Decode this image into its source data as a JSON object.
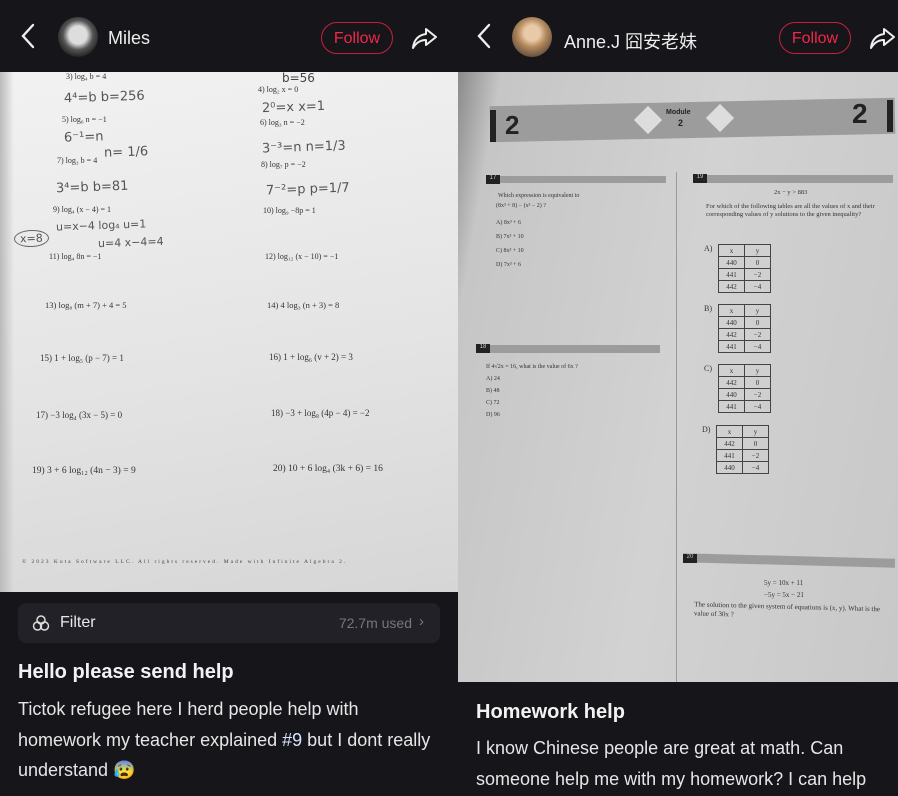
{
  "left_post": {
    "header": {
      "username": "Miles",
      "follow_label": "Follow"
    },
    "worksheet": {
      "problems": [
        "3) log₄ b = 4",
        "4) log₂ x = 0",
        "5) log₆ n = −1",
        "6) log₃ n = −2",
        "7) log₃ b = 4",
        "8) log₇ p = −2",
        "9) log₄ (x − 4) = 1",
        "10) log₉ −8p = 1",
        "11) log₄ 8n = −1",
        "12) log₁₂ (x − 10) = −1",
        "13) log₈ (m + 7) + 4 = 5",
        "14) 4 log₃ (n + 3) = 8",
        "15) 1 + log₅ (p − 7) = 1",
        "16) 1 + log₆ (v + 2) = 3",
        "17) −3 log₄ (3x − 5) = 0",
        "18) −3 + log₈ (4p − 4) = −2",
        "19) 3 + 6 log₁₂ (4n − 3) = 9",
        "20) 10 + 6 log₄ (3k + 6) = 16"
      ],
      "handwriting": [
        "4⁴=b  b=256",
        "2⁰=x   x=1",
        "6⁻¹=n",
        "n= 1/6",
        "3⁻³=n  n=1/3",
        "3⁴=b    b=81",
        "7⁻²=p   p=1/7",
        "u=x−4    log₄ u=1",
        "u=4  x−4=4",
        "x=8",
        "b=56"
      ],
      "footer": "© 2023 Kuta Software LLC.  All rights reserved.   Made with Infinite Algebra 2."
    },
    "filter": {
      "label": "Filter",
      "usage": "72.7m used",
      "icon": "filter-icon"
    },
    "title": "Hello please send help",
    "body": {
      "text_before": "Tictok refugee here I herd people help with homework my teacher explained ",
      "hashtag": "#9",
      "text_after": " but I dont really understand",
      "emoji": "😰"
    }
  },
  "right_post": {
    "header": {
      "username": "Anne.J 囧安老妹",
      "follow_label": "Follow"
    },
    "worksheet": {
      "module_left": "2",
      "module_label": "Module",
      "module_number": "2",
      "module_right": "2",
      "q17": {
        "num": "17",
        "prompt": "Which expression is equivalent to",
        "expr": "(8x³ + 8) − (x³ − 2) ?",
        "choices": [
          "A) 8x³ + 6",
          "B) 7x³ + 10",
          "C) 8x³ + 10",
          "D) 7x³ + 6"
        ]
      },
      "q18": {
        "num": "18",
        "prompt": "If 4√2x = 16, what is the value of 6x ?",
        "choices": [
          "A) 24",
          "B) 48",
          "C) 72",
          "D) 96"
        ]
      },
      "q19": {
        "num": "19",
        "inequality": "2x − y > 883",
        "prompt": "For which of the following tables are all the values of x and their corresponding values of y solutions to the given inequality?",
        "tables": [
          {
            "label": "A)",
            "rows": [
              [
                "x",
                "y"
              ],
              [
                "440",
                "0"
              ],
              [
                "441",
                "−2"
              ],
              [
                "442",
                "−4"
              ]
            ]
          },
          {
            "label": "B)",
            "rows": [
              [
                "x",
                "y"
              ],
              [
                "440",
                "0"
              ],
              [
                "442",
                "−2"
              ],
              [
                "441",
                "−4"
              ]
            ]
          },
          {
            "label": "C)",
            "rows": [
              [
                "x",
                "y"
              ],
              [
                "442",
                "0"
              ],
              [
                "440",
                "−2"
              ],
              [
                "441",
                "−4"
              ]
            ]
          },
          {
            "label": "D)",
            "rows": [
              [
                "x",
                "y"
              ],
              [
                "442",
                "0"
              ],
              [
                "441",
                "−2"
              ],
              [
                "440",
                "−4"
              ]
            ]
          }
        ]
      },
      "q20": {
        "num": "20",
        "eq1": "5y = 10x + 11",
        "eq2": "−5y = 5x − 21",
        "prompt": "The solution to the given system of equations is (x, y). What is the value of 30x ?"
      }
    },
    "title": "Homework help",
    "body": "I know Chinese people are great at math. Can someone help me with my homework? I can help"
  },
  "colors": {
    "background": "#16151a",
    "follow": "#f0284a",
    "filter_bg": "#222127"
  }
}
